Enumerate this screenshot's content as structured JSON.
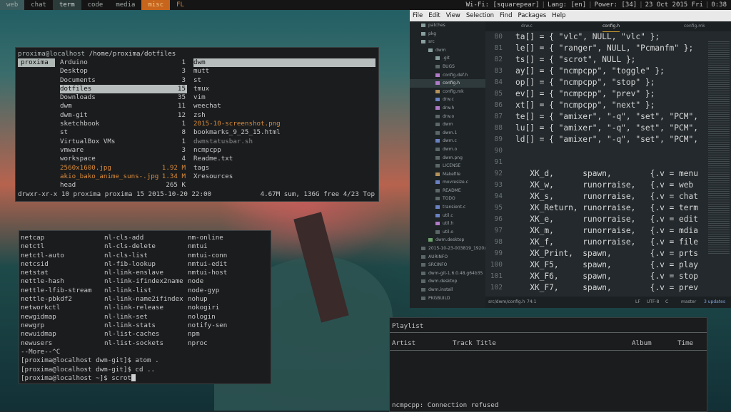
{
  "topbar": {
    "tabs": [
      "web",
      "chat",
      "term",
      "code",
      "media",
      "misc",
      "FL"
    ],
    "status": [
      "Wi-Fi: [squarepear]",
      "Lang: [en]",
      "Power: [34]",
      "23 Oct 2015 Fri",
      "0:38"
    ]
  },
  "ranger": {
    "header_user": "proxima@localhost",
    "header_path": "/home/proxima/dotfiles",
    "col1": [
      "proxima"
    ],
    "col2": [
      {
        "name": "Arduino",
        "n": "1"
      },
      {
        "name": "Desktop",
        "n": "3"
      },
      {
        "name": "Documents",
        "n": "3"
      },
      {
        "name": "dotfiles",
        "n": "15"
      },
      {
        "name": "Downloads",
        "n": "35"
      },
      {
        "name": "dwm",
        "n": "11"
      },
      {
        "name": "dwm-git",
        "n": "12"
      },
      {
        "name": "sketchbook",
        "n": "1"
      },
      {
        "name": "st",
        "n": "8"
      },
      {
        "name": "VirtualBox VMs",
        "n": "1"
      },
      {
        "name": "vmware",
        "n": "3"
      },
      {
        "name": "workspace",
        "n": "4"
      },
      {
        "name": "2560x1600.jpg",
        "n": "1.92 M"
      },
      {
        "name": "akio_bako_anime_suns-.jpg",
        "n": "1.34 M"
      },
      {
        "name": "head",
        "n": "265 K"
      }
    ],
    "col3": [
      "dwm",
      "mutt",
      "st",
      "tmux",
      "vim",
      "weechat",
      "zsh",
      "2015-10-screenshot.png",
      "bookmarks_9_25_15.html",
      "dwmstatusbar.sh",
      "ncmpcpp",
      "Readme.txt",
      "tags",
      "Xresources"
    ],
    "footer_left": "drwxr-xr-x 10 proxima proxima 15 2015-10-20 22:00",
    "footer_right": "4.67M sum, 136G free  4/23  Top"
  },
  "completion": {
    "col1": [
      "netcap",
      "netctl",
      "netctl-auto",
      "netcsid",
      "netstat",
      "nettle-hash",
      "nettle-lfib-stream",
      "nettle-pbkdf2",
      "networkctl",
      "newgidmap",
      "newgrp",
      "newuidmap",
      "newusers"
    ],
    "col2": [
      "nl-cls-add",
      "nl-cls-delete",
      "nl-cls-list",
      "nl-fib-lookup",
      "nl-link-enslave",
      "nl-link-ifindex2name",
      "nl-link-list",
      "nl-link-name2ifindex",
      "nl-link-release",
      "nl-link-set",
      "nl-link-stats",
      "nl-list-caches",
      "nl-list-sockets"
    ],
    "col3": [
      "nm-online",
      "nmtui",
      "nmtui-conn",
      "nmtui-edit",
      "nmtui-host",
      "node",
      "node-gyp",
      "nohup",
      "nokogiri",
      "nologin",
      "notify-sen",
      "npm",
      "nproc"
    ],
    "lines": [
      "--More--^C",
      "[proxima@localhost dwm-git]$ atom .",
      "[proxima@localhost dwm-git]$ cd ..",
      "[proxima@localhost ~]$ scrot"
    ]
  },
  "atom": {
    "menu": [
      "File",
      "Edit",
      "View",
      "Selection",
      "Find",
      "Packages",
      "Help"
    ],
    "tree": [
      {
        "label": "patches",
        "type": "folder",
        "depth": 1
      },
      {
        "label": "pkg",
        "type": "folder",
        "depth": 1
      },
      {
        "label": "src",
        "type": "folder",
        "depth": 1
      },
      {
        "label": "dwm",
        "type": "folder",
        "depth": 2
      },
      {
        "label": ".git",
        "type": "folder",
        "depth": 3
      },
      {
        "label": "BUGS",
        "type": "file",
        "depth": 3
      },
      {
        "label": "config.def.h",
        "type": "h",
        "depth": 3
      },
      {
        "label": "config.h",
        "type": "h",
        "depth": 3,
        "selected": true
      },
      {
        "label": "config.mk",
        "type": "mk",
        "depth": 3
      },
      {
        "label": "drw.c",
        "type": "c",
        "depth": 3
      },
      {
        "label": "drw.h",
        "type": "h",
        "depth": 3
      },
      {
        "label": "drw.o",
        "type": "file",
        "depth": 3
      },
      {
        "label": "dwm",
        "type": "file",
        "depth": 3
      },
      {
        "label": "dwm.1",
        "type": "file",
        "depth": 3
      },
      {
        "label": "dwm.c",
        "type": "c",
        "depth": 3
      },
      {
        "label": "dwm.o",
        "type": "file",
        "depth": 3
      },
      {
        "label": "dwm.png",
        "type": "file",
        "depth": 3
      },
      {
        "label": "LICENSE",
        "type": "file",
        "depth": 3
      },
      {
        "label": "Makefile",
        "type": "mk",
        "depth": 3
      },
      {
        "label": "movresize.c",
        "type": "c",
        "depth": 3
      },
      {
        "label": "README",
        "type": "file",
        "depth": 3
      },
      {
        "label": "TODO",
        "type": "file",
        "depth": 3
      },
      {
        "label": "transient.c",
        "type": "c",
        "depth": 3
      },
      {
        "label": "util.c",
        "type": "c",
        "depth": 3
      },
      {
        "label": "util.h",
        "type": "h",
        "depth": 3
      },
      {
        "label": "util.o",
        "type": "file",
        "depth": 3
      },
      {
        "label": "dwm.desktop",
        "type": "ds",
        "depth": 2
      },
      {
        "label": "2015-10-23-003819_1920x",
        "type": "file",
        "depth": 1
      },
      {
        "label": "AURINFO",
        "type": "file",
        "depth": 1
      },
      {
        "label": "SRCINFO",
        "type": "file",
        "depth": 1
      },
      {
        "label": "dwm-git-1.6.0.48.g64b35",
        "type": "file",
        "depth": 1
      },
      {
        "label": "dwm.desktop",
        "type": "file",
        "depth": 1
      },
      {
        "label": "dwm.install",
        "type": "file",
        "depth": 1
      },
      {
        "label": "PKGBUILD",
        "type": "file",
        "depth": 1
      }
    ],
    "tabs": [
      "drw.c",
      "config.h",
      "config.mk"
    ],
    "lines": [
      {
        "n": "80",
        "t": "ta[] = { \"vlc\", NULL, \"vlc\" };"
      },
      {
        "n": "81",
        "t": "le[] = { \"ranger\", NULL, \"Pcmanfm\" };"
      },
      {
        "n": "82",
        "t": "ts[] = { \"scrot\", NULL };"
      },
      {
        "n": "83",
        "t": "ay[] = { \"ncmpcpp\", \"toggle\" };"
      },
      {
        "n": "84",
        "t": "op[] = { \"ncmpcpp\", \"stop\" };"
      },
      {
        "n": "85",
        "t": "ev[] = { \"ncmpcpp\", \"prev\" };"
      },
      {
        "n": "86",
        "t": "xt[] = { \"ncmpcpp\", \"next\" };"
      },
      {
        "n": "87",
        "t": "te[] = { \"amixer\", \"-q\", \"set\", \"PCM\", \"t"
      },
      {
        "n": "88",
        "t": "lu[] = { \"amixer\", \"-q\", \"set\", \"PCM\", \"5"
      },
      {
        "n": "89",
        "t": "ld[] = { \"amixer\", \"-q\", \"set\", \"PCM\", \"5"
      },
      {
        "n": "90",
        "t": ""
      },
      {
        "n": "91",
        "t": ""
      },
      {
        "n": "92",
        "t": "   XK_d,      spawn,        {.v = menu"
      },
      {
        "n": "93",
        "t": "   XK_w,      runorraise,   {.v = web"
      },
      {
        "n": "94",
        "t": "   XK_s,      runorraise,   {.v = chat"
      },
      {
        "n": "95",
        "t": "   XK_Return, runorraise,   {.v = term"
      },
      {
        "n": "96",
        "t": "   XK_e,      runorraise,   {.v = edit"
      },
      {
        "n": "97",
        "t": "   XK_m,      runorraise,   {.v = mdia"
      },
      {
        "n": "98",
        "t": "   XK_f,      runorraise,   {.v = file"
      },
      {
        "n": "99",
        "t": "   XK_Print,  spawn,        {.v = prts"
      },
      {
        "n": "100",
        "t": "   XK_F5,     spawn,        {.v = play"
      },
      {
        "n": "101",
        "t": "   XK_F6,     spawn,        {.v = stop"
      },
      {
        "n": "102",
        "t": "   XK_F7,     spawn,        {.v = prev"
      }
    ],
    "status": {
      "path": "src/dwm/config.h",
      "pos": "74:1",
      "lf": "LF",
      "enc": "UTF-8",
      "lang": "C",
      "branch": "master",
      "updates": "3 updates"
    }
  },
  "ncmpcpp": {
    "title": "Playlist",
    "columns": [
      "Artist",
      "Track Title",
      "Album",
      "Time"
    ],
    "error": "ncmpcpp: Connection refused"
  }
}
